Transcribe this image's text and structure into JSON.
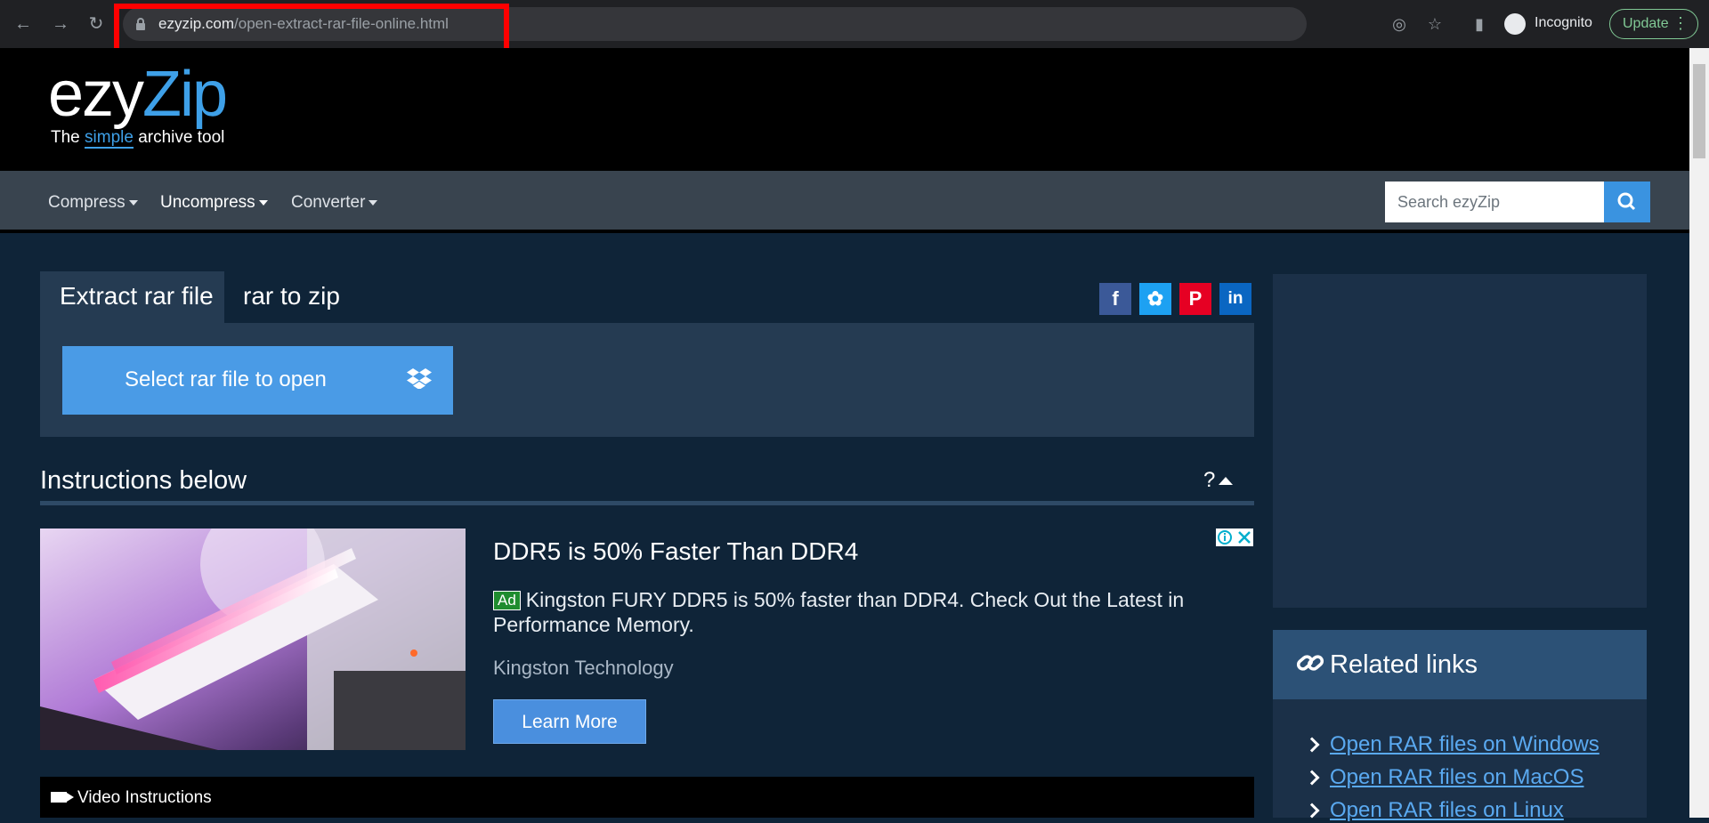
{
  "browser": {
    "url_domain": "ezyzip.com",
    "url_path": "/open-extract-rar-file-online.html",
    "profile_label": "Incognito",
    "update_label": "Update"
  },
  "site": {
    "logo_part1": "ezy",
    "logo_part2": "Zip",
    "tagline_pre": "The ",
    "tagline_em": "simple",
    "tagline_post": " archive tool"
  },
  "nav": {
    "items": [
      "Compress",
      "Uncompress",
      "Converter"
    ],
    "search_placeholder": "Search ezyZip"
  },
  "tabs": {
    "active": "Extract rar file",
    "other": "rar to zip"
  },
  "upload": {
    "button_label": "Select rar file to open"
  },
  "instructions": {
    "title": "Instructions below",
    "help": "?"
  },
  "ad": {
    "title": "DDR5 is 50% Faster Than DDR4",
    "badge": "Ad",
    "text": "Kingston FURY DDR5 is 50% faster than DDR4. Check Out the Latest in Performance Memory.",
    "brand": "Kingston Technology",
    "cta": "Learn More"
  },
  "video": {
    "label": "Video Instructions"
  },
  "related": {
    "title": "Related links",
    "links": [
      "Open RAR files on Windows",
      "Open RAR files on MacOS",
      "Open RAR files on Linux"
    ]
  },
  "colors": {
    "page_bg": "#0f2438",
    "accent": "#3ea0e8",
    "button": "#4a9be6",
    "highlight_box": "#ff0000"
  }
}
